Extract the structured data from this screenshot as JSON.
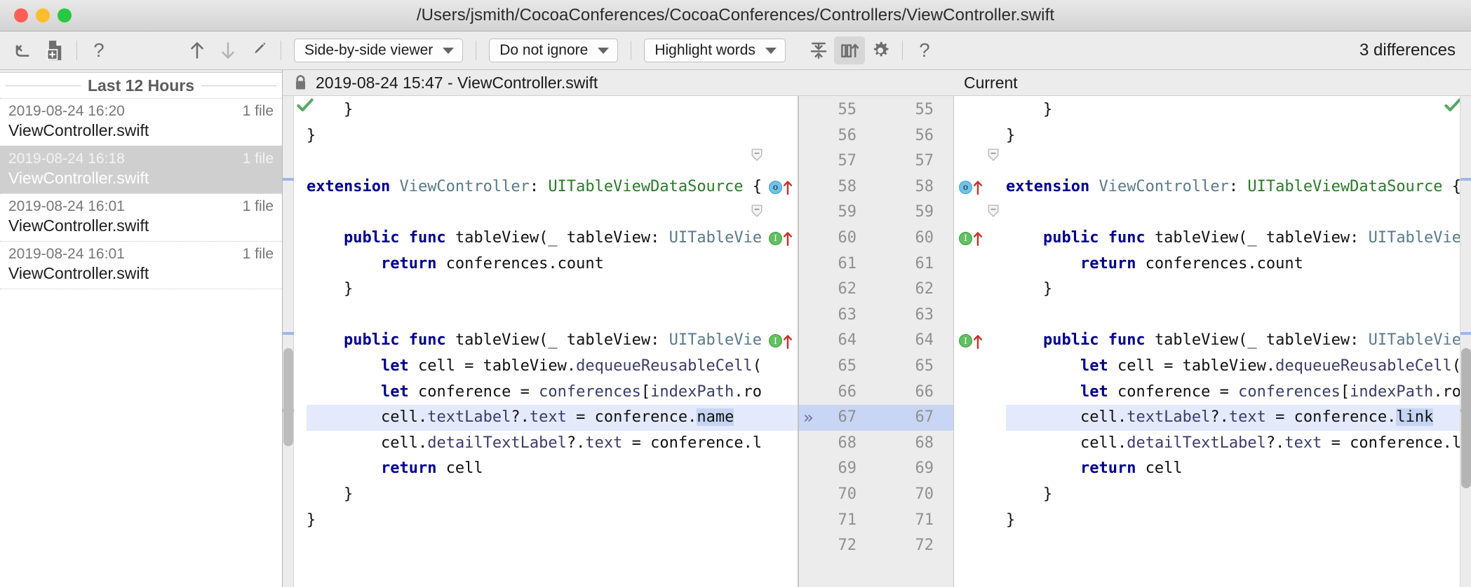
{
  "window": {
    "title": "/Users/jsmith/CocoaConferences/CocoaConferences/Controllers/ViewController.swift",
    "buttons": {
      "close": "close-button",
      "minimize": "minimize-button",
      "zoom": "zoom-button"
    }
  },
  "toolbar": {
    "revert_icon": "undo-icon",
    "create_patch_icon": "create-patch-icon",
    "help_left_icon": "help-icon",
    "prev_diff_icon": "arrow-up-icon",
    "next_diff_icon": "arrow-down-icon",
    "edit_icon": "pencil-icon",
    "viewer_mode": "Side-by-side viewer",
    "ignore_policy": "Do not ignore",
    "highlight_policy": "Highlight words",
    "collapse_icon": "collapse-unchanged-icon",
    "whitespace_icon": "show-diff-in-columns-icon",
    "settings_icon": "gear-icon",
    "help_icon": "help-icon",
    "difference_count": "3 differences"
  },
  "sidebar": {
    "group_title": "Last 12 Hours",
    "revisions": [
      {
        "timestamp": "2019-08-24 16:20",
        "files": "1 file",
        "filename": "ViewController.swift",
        "selected": false
      },
      {
        "timestamp": "2019-08-24 16:18",
        "files": "1 file",
        "filename": "ViewController.swift",
        "selected": true
      },
      {
        "timestamp": "2019-08-24 16:01",
        "files": "1 file",
        "filename": "ViewController.swift",
        "selected": false
      },
      {
        "timestamp": "2019-08-24 16:01",
        "files": "1 file",
        "filename": "ViewController.swift",
        "selected": false
      }
    ]
  },
  "diff": {
    "left_title": "2019-08-24 15:47 - ViewController.swift",
    "left_lock_icon": "lock-icon",
    "right_title": "Current",
    "line_numbers_left": [
      "55",
      "56",
      "57",
      "58",
      "59",
      "60",
      "61",
      "62",
      "63",
      "64",
      "65",
      "66",
      "67",
      "68",
      "69",
      "70",
      "71",
      "72"
    ],
    "line_numbers_right": [
      "55",
      "56",
      "57",
      "58",
      "59",
      "60",
      "61",
      "62",
      "63",
      "64",
      "65",
      "66",
      "67",
      "68",
      "69",
      "70",
      "71",
      "72"
    ],
    "highlighted_line": "67",
    "left_lines": [
      {
        "n": "55",
        "segments": [
          {
            "t": "    }",
            "c": "pln"
          }
        ]
      },
      {
        "n": "56",
        "segments": [
          {
            "t": "}",
            "c": "pln"
          }
        ]
      },
      {
        "n": "57",
        "segments": [
          {
            "t": "",
            "c": "pln"
          }
        ]
      },
      {
        "n": "58",
        "segments": [
          {
            "t": "extension ",
            "c": "kw"
          },
          {
            "t": "ViewController",
            "c": "cls"
          },
          {
            "t": ": ",
            "c": "pln"
          },
          {
            "t": "UITableViewDataSource",
            "c": "typ"
          },
          {
            "t": " {",
            "c": "pln"
          }
        ]
      },
      {
        "n": "59",
        "segments": [
          {
            "t": "",
            "c": "pln"
          }
        ]
      },
      {
        "n": "60",
        "segments": [
          {
            "t": "    ",
            "c": "pln"
          },
          {
            "t": "public func ",
            "c": "kw"
          },
          {
            "t": "tableView",
            "c": "pln"
          },
          {
            "t": "(",
            "c": "pln"
          },
          {
            "t": "_ ",
            "c": "pln"
          },
          {
            "t": "tableView",
            "c": "pln"
          },
          {
            "t": ": ",
            "c": "pln"
          },
          {
            "t": "UITableVie",
            "c": "cls"
          }
        ]
      },
      {
        "n": "61",
        "segments": [
          {
            "t": "        ",
            "c": "pln"
          },
          {
            "t": "return ",
            "c": "kw"
          },
          {
            "t": "conferences.count",
            "c": "pln"
          }
        ]
      },
      {
        "n": "62",
        "segments": [
          {
            "t": "    }",
            "c": "pln"
          }
        ]
      },
      {
        "n": "63",
        "segments": [
          {
            "t": "",
            "c": "pln"
          }
        ]
      },
      {
        "n": "64",
        "segments": [
          {
            "t": "    ",
            "c": "pln"
          },
          {
            "t": "public func ",
            "c": "kw"
          },
          {
            "t": "tableView(_ tableView: ",
            "c": "pln"
          },
          {
            "t": "UITableVie",
            "c": "cls"
          }
        ]
      },
      {
        "n": "65",
        "segments": [
          {
            "t": "        ",
            "c": "pln"
          },
          {
            "t": "let ",
            "c": "kw"
          },
          {
            "t": "cell = tableView.",
            "c": "pln"
          },
          {
            "t": "dequeueReusableCell",
            "c": "idn"
          },
          {
            "t": "(",
            "c": "pln"
          }
        ]
      },
      {
        "n": "66",
        "segments": [
          {
            "t": "        ",
            "c": "pln"
          },
          {
            "t": "let ",
            "c": "kw"
          },
          {
            "t": "conference = ",
            "c": "pln"
          },
          {
            "t": "conferences",
            "c": "idn"
          },
          {
            "t": "[",
            "c": "pln"
          },
          {
            "t": "indexPath",
            "c": "idn"
          },
          {
            "t": ".ro",
            "c": "pln"
          }
        ]
      },
      {
        "n": "67",
        "segments": [
          {
            "t": "        ",
            "c": "pln"
          },
          {
            "t": "cell",
            "c": "pln"
          },
          {
            "t": ".",
            "c": "pln"
          },
          {
            "t": "textLabel",
            "c": "idn"
          },
          {
            "t": "?.",
            "c": "pln"
          },
          {
            "t": "text",
            "c": "idn"
          },
          {
            "t": " = ",
            "c": "pln"
          },
          {
            "t": "conference",
            "c": "pln"
          },
          {
            "t": ".",
            "c": "pln"
          },
          {
            "t": "name",
            "c": "sel"
          }
        ]
      },
      {
        "n": "68",
        "segments": [
          {
            "t": "        ",
            "c": "pln"
          },
          {
            "t": "cell",
            "c": "pln"
          },
          {
            "t": ".",
            "c": "pln"
          },
          {
            "t": "detailTextLabel",
            "c": "idn"
          },
          {
            "t": "?.",
            "c": "pln"
          },
          {
            "t": "text",
            "c": "idn"
          },
          {
            "t": " = ",
            "c": "pln"
          },
          {
            "t": "conference",
            "c": "pln"
          },
          {
            "t": ".l",
            "c": "pln"
          }
        ]
      },
      {
        "n": "69",
        "segments": [
          {
            "t": "        ",
            "c": "pln"
          },
          {
            "t": "return ",
            "c": "kw"
          },
          {
            "t": "cell",
            "c": "pln"
          }
        ]
      },
      {
        "n": "70",
        "segments": [
          {
            "t": "    }",
            "c": "pln"
          }
        ]
      },
      {
        "n": "71",
        "segments": [
          {
            "t": "}",
            "c": "pln"
          }
        ]
      },
      {
        "n": "72",
        "segments": [
          {
            "t": "",
            "c": "pln"
          }
        ]
      }
    ],
    "right_lines": [
      {
        "n": "55",
        "segments": [
          {
            "t": "    }",
            "c": "pln"
          }
        ]
      },
      {
        "n": "56",
        "segments": [
          {
            "t": "}",
            "c": "pln"
          }
        ]
      },
      {
        "n": "57",
        "segments": [
          {
            "t": "",
            "c": "pln"
          }
        ]
      },
      {
        "n": "58",
        "segments": [
          {
            "t": "extension ",
            "c": "kw"
          },
          {
            "t": "ViewController",
            "c": "cls"
          },
          {
            "t": ": ",
            "c": "pln"
          },
          {
            "t": "UITableViewDataSource",
            "c": "typ"
          },
          {
            "t": " {",
            "c": "pln"
          }
        ]
      },
      {
        "n": "59",
        "segments": [
          {
            "t": "",
            "c": "pln"
          }
        ]
      },
      {
        "n": "60",
        "segments": [
          {
            "t": "    ",
            "c": "pln"
          },
          {
            "t": "public func ",
            "c": "kw"
          },
          {
            "t": "tableView(_ tableView: ",
            "c": "pln"
          },
          {
            "t": "UITableView.",
            "c": "cls"
          }
        ]
      },
      {
        "n": "61",
        "segments": [
          {
            "t": "        ",
            "c": "pln"
          },
          {
            "t": "return ",
            "c": "kw"
          },
          {
            "t": "conferences.count",
            "c": "pln"
          }
        ]
      },
      {
        "n": "62",
        "segments": [
          {
            "t": "    }",
            "c": "pln"
          }
        ]
      },
      {
        "n": "63",
        "segments": [
          {
            "t": "",
            "c": "pln"
          }
        ]
      },
      {
        "n": "64",
        "segments": [
          {
            "t": "    ",
            "c": "pln"
          },
          {
            "t": "public func ",
            "c": "kw"
          },
          {
            "t": "tableView(_ tableView: ",
            "c": "pln"
          },
          {
            "t": "UITableView,",
            "c": "cls"
          }
        ]
      },
      {
        "n": "65",
        "segments": [
          {
            "t": "        ",
            "c": "pln"
          },
          {
            "t": "let ",
            "c": "kw"
          },
          {
            "t": "cell = tableView.",
            "c": "pln"
          },
          {
            "t": "dequeueReusableCell",
            "c": "idn"
          },
          {
            "t": "(wi",
            "c": "pln"
          }
        ]
      },
      {
        "n": "66",
        "segments": [
          {
            "t": "        ",
            "c": "pln"
          },
          {
            "t": "let ",
            "c": "kw"
          },
          {
            "t": "conference = ",
            "c": "pln"
          },
          {
            "t": "conferences",
            "c": "idn"
          },
          {
            "t": "[",
            "c": "pln"
          },
          {
            "t": "indexPath",
            "c": "idn"
          },
          {
            "t": ".row]",
            "c": "pln"
          }
        ]
      },
      {
        "n": "67",
        "segments": [
          {
            "t": "        ",
            "c": "pln"
          },
          {
            "t": "cell",
            "c": "pln"
          },
          {
            "t": ".",
            "c": "pln"
          },
          {
            "t": "textLabel",
            "c": "idn"
          },
          {
            "t": "?.",
            "c": "pln"
          },
          {
            "t": "text",
            "c": "idn"
          },
          {
            "t": " = ",
            "c": "pln"
          },
          {
            "t": "conference",
            "c": "pln"
          },
          {
            "t": ".",
            "c": "pln"
          },
          {
            "t": "link",
            "c": "sel"
          }
        ]
      },
      {
        "n": "68",
        "segments": [
          {
            "t": "        ",
            "c": "pln"
          },
          {
            "t": "cell",
            "c": "pln"
          },
          {
            "t": ".",
            "c": "pln"
          },
          {
            "t": "detailTextLabel",
            "c": "idn"
          },
          {
            "t": "?.",
            "c": "pln"
          },
          {
            "t": "text",
            "c": "idn"
          },
          {
            "t": " = ",
            "c": "pln"
          },
          {
            "t": "conference",
            "c": "pln"
          },
          {
            "t": ".loca",
            "c": "pln"
          }
        ]
      },
      {
        "n": "69",
        "segments": [
          {
            "t": "        ",
            "c": "pln"
          },
          {
            "t": "return ",
            "c": "kw"
          },
          {
            "t": "cell",
            "c": "pln"
          }
        ]
      },
      {
        "n": "70",
        "segments": [
          {
            "t": "    }",
            "c": "pln"
          }
        ]
      },
      {
        "n": "71",
        "segments": [
          {
            "t": "}",
            "c": "pln"
          }
        ]
      },
      {
        "n": "72",
        "segments": [
          {
            "t": "",
            "c": "pln"
          }
        ]
      }
    ],
    "gutter_markers": [
      {
        "line": "58",
        "badge": "o",
        "kind": "override",
        "arrow": "up"
      },
      {
        "line": "60",
        "badge": "I",
        "kind": "implements",
        "arrow": "up"
      },
      {
        "line": "64",
        "badge": "I",
        "kind": "implements",
        "arrow": "up"
      }
    ],
    "status_icon_left": "inspection-ok-checkmark",
    "status_icon_right": "inspection-ok-checkmark"
  },
  "colors": {
    "accent_selection": "#c5d4f2",
    "diff_line_highlight": "#e4eafb",
    "gutter_highlight": "#c9d5f5",
    "keyword": "#00008f",
    "type": "#2a7a2a",
    "class": "#5a7a8c",
    "identifier": "#3b3b6e",
    "ok_green": "#59a869",
    "marker_blue": "#6fc2e8",
    "marker_green": "#63bf63",
    "arrow_red": "#c9302c"
  }
}
